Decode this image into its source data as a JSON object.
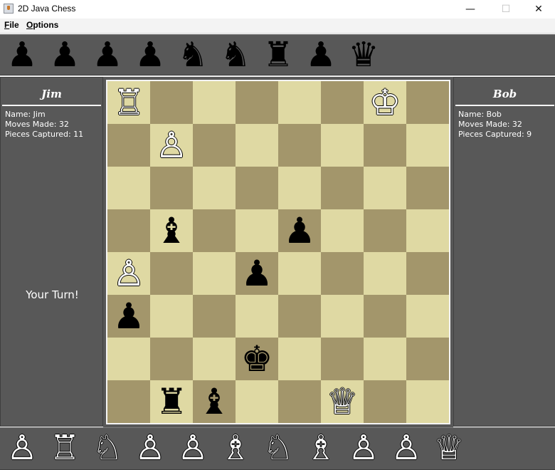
{
  "window": {
    "title": "2D Java Chess",
    "minimize": "—",
    "maximize": "☐",
    "close": "✕"
  },
  "menu": [
    {
      "label": "File"
    },
    {
      "label": "Options"
    }
  ],
  "captured_top": [
    "♟",
    "♟",
    "♟",
    "♟",
    "♞",
    "♞",
    "♜",
    "♟",
    "♛"
  ],
  "captured_bottom": [
    "♙",
    "♖",
    "♘",
    "♙",
    "♙",
    "♗",
    "♘",
    "♗",
    "♙",
    "♙",
    "♕"
  ],
  "player_left": {
    "header": "Jim",
    "name_line": "Name: Jim",
    "moves_line": "Moves Made: 32",
    "captured_line": "Pieces Captured: 11",
    "turn": "Your Turn!"
  },
  "player_right": {
    "header": "Bob",
    "name_line": "Name: Bob",
    "moves_line": "Moves Made: 32",
    "captured_line": "Pieces Captured: 9"
  },
  "board": [
    [
      "R",
      "",
      "",
      "",
      "",
      "",
      "K",
      ""
    ],
    [
      "",
      "P",
      "",
      "",
      "",
      "",
      "",
      ""
    ],
    [
      "",
      "",
      "",
      "",
      "",
      "",
      "",
      ""
    ],
    [
      "",
      "b",
      "",
      "",
      "p",
      "",
      "",
      ""
    ],
    [
      "P",
      "",
      "",
      "p",
      "",
      "",
      "",
      ""
    ],
    [
      "p",
      "",
      "",
      "",
      "",
      "",
      "",
      ""
    ],
    [
      "",
      "",
      "",
      "k",
      "",
      "",
      "",
      ""
    ],
    [
      "",
      "r",
      "b",
      "",
      "",
      "Q",
      "",
      ""
    ]
  ],
  "colors": {
    "light_square": "#dfd9a3",
    "dark_square": "#a3966b",
    "panel": "#585858"
  }
}
